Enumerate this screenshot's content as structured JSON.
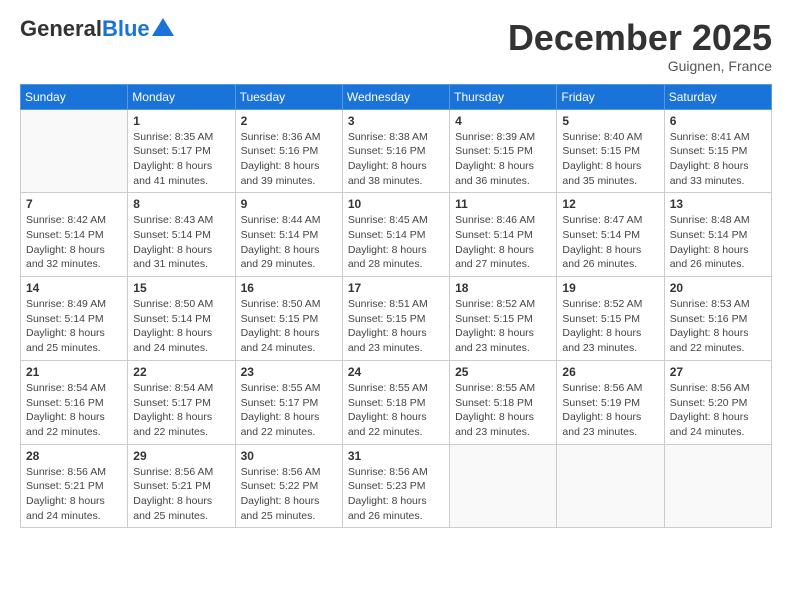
{
  "header": {
    "logo_general": "General",
    "logo_blue": "Blue",
    "month_title": "December 2025",
    "location": "Guignen, France"
  },
  "weekdays": [
    "Sunday",
    "Monday",
    "Tuesday",
    "Wednesday",
    "Thursday",
    "Friday",
    "Saturday"
  ],
  "weeks": [
    [
      {
        "day": "",
        "sunrise": "",
        "sunset": "",
        "daylight": ""
      },
      {
        "day": "1",
        "sunrise": "Sunrise: 8:35 AM",
        "sunset": "Sunset: 5:17 PM",
        "daylight": "Daylight: 8 hours and 41 minutes."
      },
      {
        "day": "2",
        "sunrise": "Sunrise: 8:36 AM",
        "sunset": "Sunset: 5:16 PM",
        "daylight": "Daylight: 8 hours and 39 minutes."
      },
      {
        "day": "3",
        "sunrise": "Sunrise: 8:38 AM",
        "sunset": "Sunset: 5:16 PM",
        "daylight": "Daylight: 8 hours and 38 minutes."
      },
      {
        "day": "4",
        "sunrise": "Sunrise: 8:39 AM",
        "sunset": "Sunset: 5:15 PM",
        "daylight": "Daylight: 8 hours and 36 minutes."
      },
      {
        "day": "5",
        "sunrise": "Sunrise: 8:40 AM",
        "sunset": "Sunset: 5:15 PM",
        "daylight": "Daylight: 8 hours and 35 minutes."
      },
      {
        "day": "6",
        "sunrise": "Sunrise: 8:41 AM",
        "sunset": "Sunset: 5:15 PM",
        "daylight": "Daylight: 8 hours and 33 minutes."
      }
    ],
    [
      {
        "day": "7",
        "sunrise": "Sunrise: 8:42 AM",
        "sunset": "Sunset: 5:14 PM",
        "daylight": "Daylight: 8 hours and 32 minutes."
      },
      {
        "day": "8",
        "sunrise": "Sunrise: 8:43 AM",
        "sunset": "Sunset: 5:14 PM",
        "daylight": "Daylight: 8 hours and 31 minutes."
      },
      {
        "day": "9",
        "sunrise": "Sunrise: 8:44 AM",
        "sunset": "Sunset: 5:14 PM",
        "daylight": "Daylight: 8 hours and 29 minutes."
      },
      {
        "day": "10",
        "sunrise": "Sunrise: 8:45 AM",
        "sunset": "Sunset: 5:14 PM",
        "daylight": "Daylight: 8 hours and 28 minutes."
      },
      {
        "day": "11",
        "sunrise": "Sunrise: 8:46 AM",
        "sunset": "Sunset: 5:14 PM",
        "daylight": "Daylight: 8 hours and 27 minutes."
      },
      {
        "day": "12",
        "sunrise": "Sunrise: 8:47 AM",
        "sunset": "Sunset: 5:14 PM",
        "daylight": "Daylight: 8 hours and 26 minutes."
      },
      {
        "day": "13",
        "sunrise": "Sunrise: 8:48 AM",
        "sunset": "Sunset: 5:14 PM",
        "daylight": "Daylight: 8 hours and 26 minutes."
      }
    ],
    [
      {
        "day": "14",
        "sunrise": "Sunrise: 8:49 AM",
        "sunset": "Sunset: 5:14 PM",
        "daylight": "Daylight: 8 hours and 25 minutes."
      },
      {
        "day": "15",
        "sunrise": "Sunrise: 8:50 AM",
        "sunset": "Sunset: 5:14 PM",
        "daylight": "Daylight: 8 hours and 24 minutes."
      },
      {
        "day": "16",
        "sunrise": "Sunrise: 8:50 AM",
        "sunset": "Sunset: 5:15 PM",
        "daylight": "Daylight: 8 hours and 24 minutes."
      },
      {
        "day": "17",
        "sunrise": "Sunrise: 8:51 AM",
        "sunset": "Sunset: 5:15 PM",
        "daylight": "Daylight: 8 hours and 23 minutes."
      },
      {
        "day": "18",
        "sunrise": "Sunrise: 8:52 AM",
        "sunset": "Sunset: 5:15 PM",
        "daylight": "Daylight: 8 hours and 23 minutes."
      },
      {
        "day": "19",
        "sunrise": "Sunrise: 8:52 AM",
        "sunset": "Sunset: 5:15 PM",
        "daylight": "Daylight: 8 hours and 23 minutes."
      },
      {
        "day": "20",
        "sunrise": "Sunrise: 8:53 AM",
        "sunset": "Sunset: 5:16 PM",
        "daylight": "Daylight: 8 hours and 22 minutes."
      }
    ],
    [
      {
        "day": "21",
        "sunrise": "Sunrise: 8:54 AM",
        "sunset": "Sunset: 5:16 PM",
        "daylight": "Daylight: 8 hours and 22 minutes."
      },
      {
        "day": "22",
        "sunrise": "Sunrise: 8:54 AM",
        "sunset": "Sunset: 5:17 PM",
        "daylight": "Daylight: 8 hours and 22 minutes."
      },
      {
        "day": "23",
        "sunrise": "Sunrise: 8:55 AM",
        "sunset": "Sunset: 5:17 PM",
        "daylight": "Daylight: 8 hours and 22 minutes."
      },
      {
        "day": "24",
        "sunrise": "Sunrise: 8:55 AM",
        "sunset": "Sunset: 5:18 PM",
        "daylight": "Daylight: 8 hours and 22 minutes."
      },
      {
        "day": "25",
        "sunrise": "Sunrise: 8:55 AM",
        "sunset": "Sunset: 5:18 PM",
        "daylight": "Daylight: 8 hours and 23 minutes."
      },
      {
        "day": "26",
        "sunrise": "Sunrise: 8:56 AM",
        "sunset": "Sunset: 5:19 PM",
        "daylight": "Daylight: 8 hours and 23 minutes."
      },
      {
        "day": "27",
        "sunrise": "Sunrise: 8:56 AM",
        "sunset": "Sunset: 5:20 PM",
        "daylight": "Daylight: 8 hours and 24 minutes."
      }
    ],
    [
      {
        "day": "28",
        "sunrise": "Sunrise: 8:56 AM",
        "sunset": "Sunset: 5:21 PM",
        "daylight": "Daylight: 8 hours and 24 minutes."
      },
      {
        "day": "29",
        "sunrise": "Sunrise: 8:56 AM",
        "sunset": "Sunset: 5:21 PM",
        "daylight": "Daylight: 8 hours and 25 minutes."
      },
      {
        "day": "30",
        "sunrise": "Sunrise: 8:56 AM",
        "sunset": "Sunset: 5:22 PM",
        "daylight": "Daylight: 8 hours and 25 minutes."
      },
      {
        "day": "31",
        "sunrise": "Sunrise: 8:56 AM",
        "sunset": "Sunset: 5:23 PM",
        "daylight": "Daylight: 8 hours and 26 minutes."
      },
      {
        "day": "",
        "sunrise": "",
        "sunset": "",
        "daylight": ""
      },
      {
        "day": "",
        "sunrise": "",
        "sunset": "",
        "daylight": ""
      },
      {
        "day": "",
        "sunrise": "",
        "sunset": "",
        "daylight": ""
      }
    ]
  ]
}
